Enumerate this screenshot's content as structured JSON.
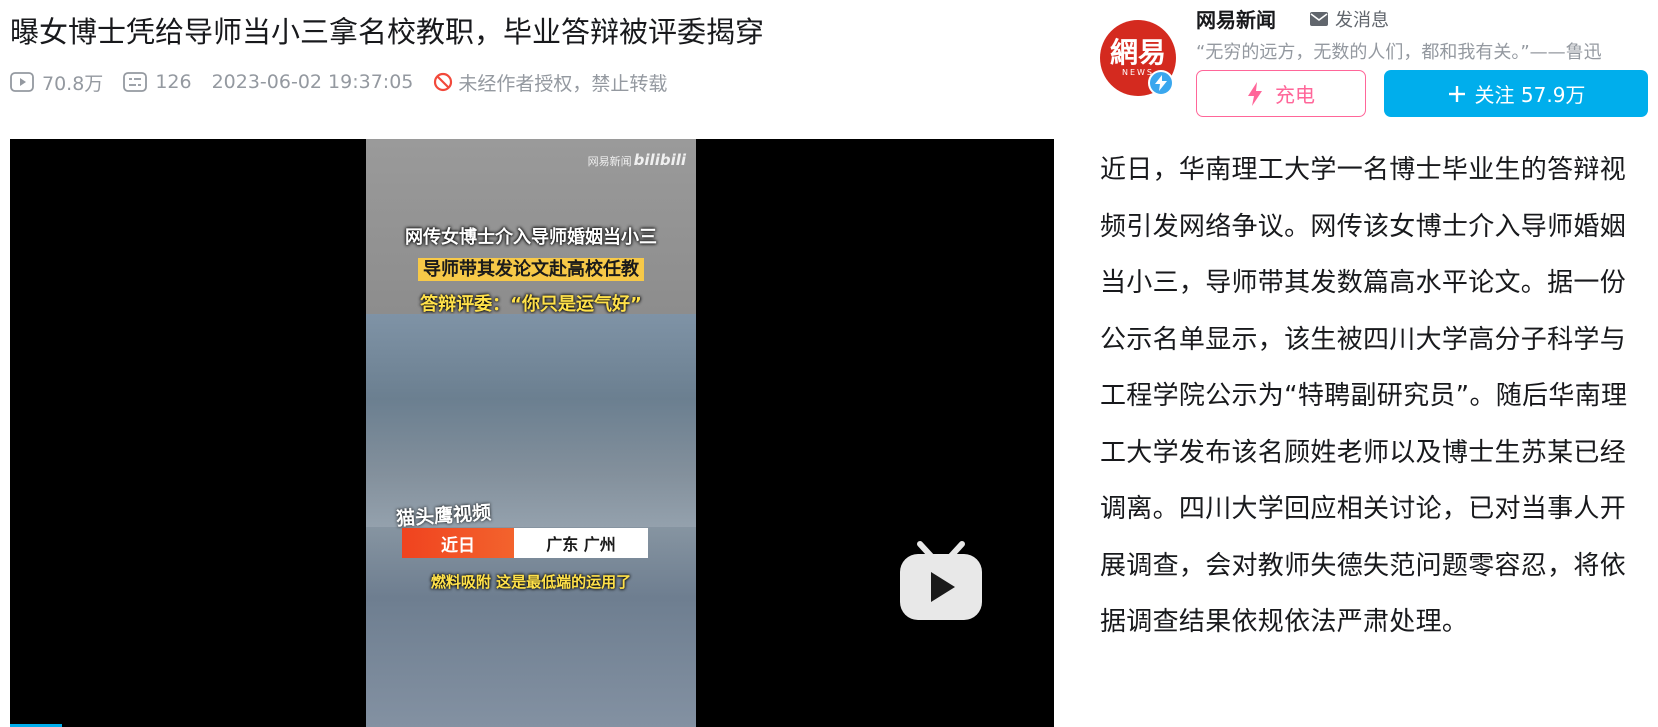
{
  "video": {
    "title": "曝女博士凭给导师当小三拿名校教职，毕业答辩被评委揭穿",
    "views": "70.8万",
    "danmaku": "126",
    "pubdate": "2023-06-02 19:37:05",
    "copyright_notice": "未经作者授权，禁止转载"
  },
  "player": {
    "watermark_source": "网易新闻",
    "watermark_logo": "bilibili",
    "caption_line1": "网传女博士介入导师婚姻当小三",
    "caption_line2": "导师带其发论文赴高校任教",
    "caption_line3": "答辩评委：“你只是运气好”",
    "brand_text": "猫头鹰视频",
    "location_tag_time": "近日",
    "location_tag_place": "广东  广州",
    "subtitle": "燃料吸附 这是最低端的运用了",
    "play_icon": "bilibili-tv-play-icon",
    "progress": 0.05
  },
  "uploader": {
    "name": "网易新闻",
    "avatar_text_cn": "網易",
    "avatar_text_en": "NEWS",
    "send_message_label": "发消息",
    "signature": "“无穷的远方，无数的人们，都和我有关。”——鲁迅",
    "charge_label": "充电",
    "follow_label": "关注 57.9万"
  },
  "description": "近日，华南理工大学一名博士毕业生的答辩视频引发网络争议。网传该女博士介入导师婚姻当小三，导师带其发数篇高水平论文。据一份公示名单显示，该生被四川大学高分子科学与工程学院公示为“特聘副研究员”。随后华南理工大学发布该名顾姓老师以及博士生苏某已经调离。四川大学回应相关讨论，已对当事人开展调查，会对教师失德失范问题零容忍，将依据调查结果依规依法严肃处理。",
  "colors": {
    "accent_blue": "#00aeec",
    "charge_pink": "#ff6699",
    "meta_gray": "#9499a0",
    "forbid_red": "#f2493b"
  }
}
